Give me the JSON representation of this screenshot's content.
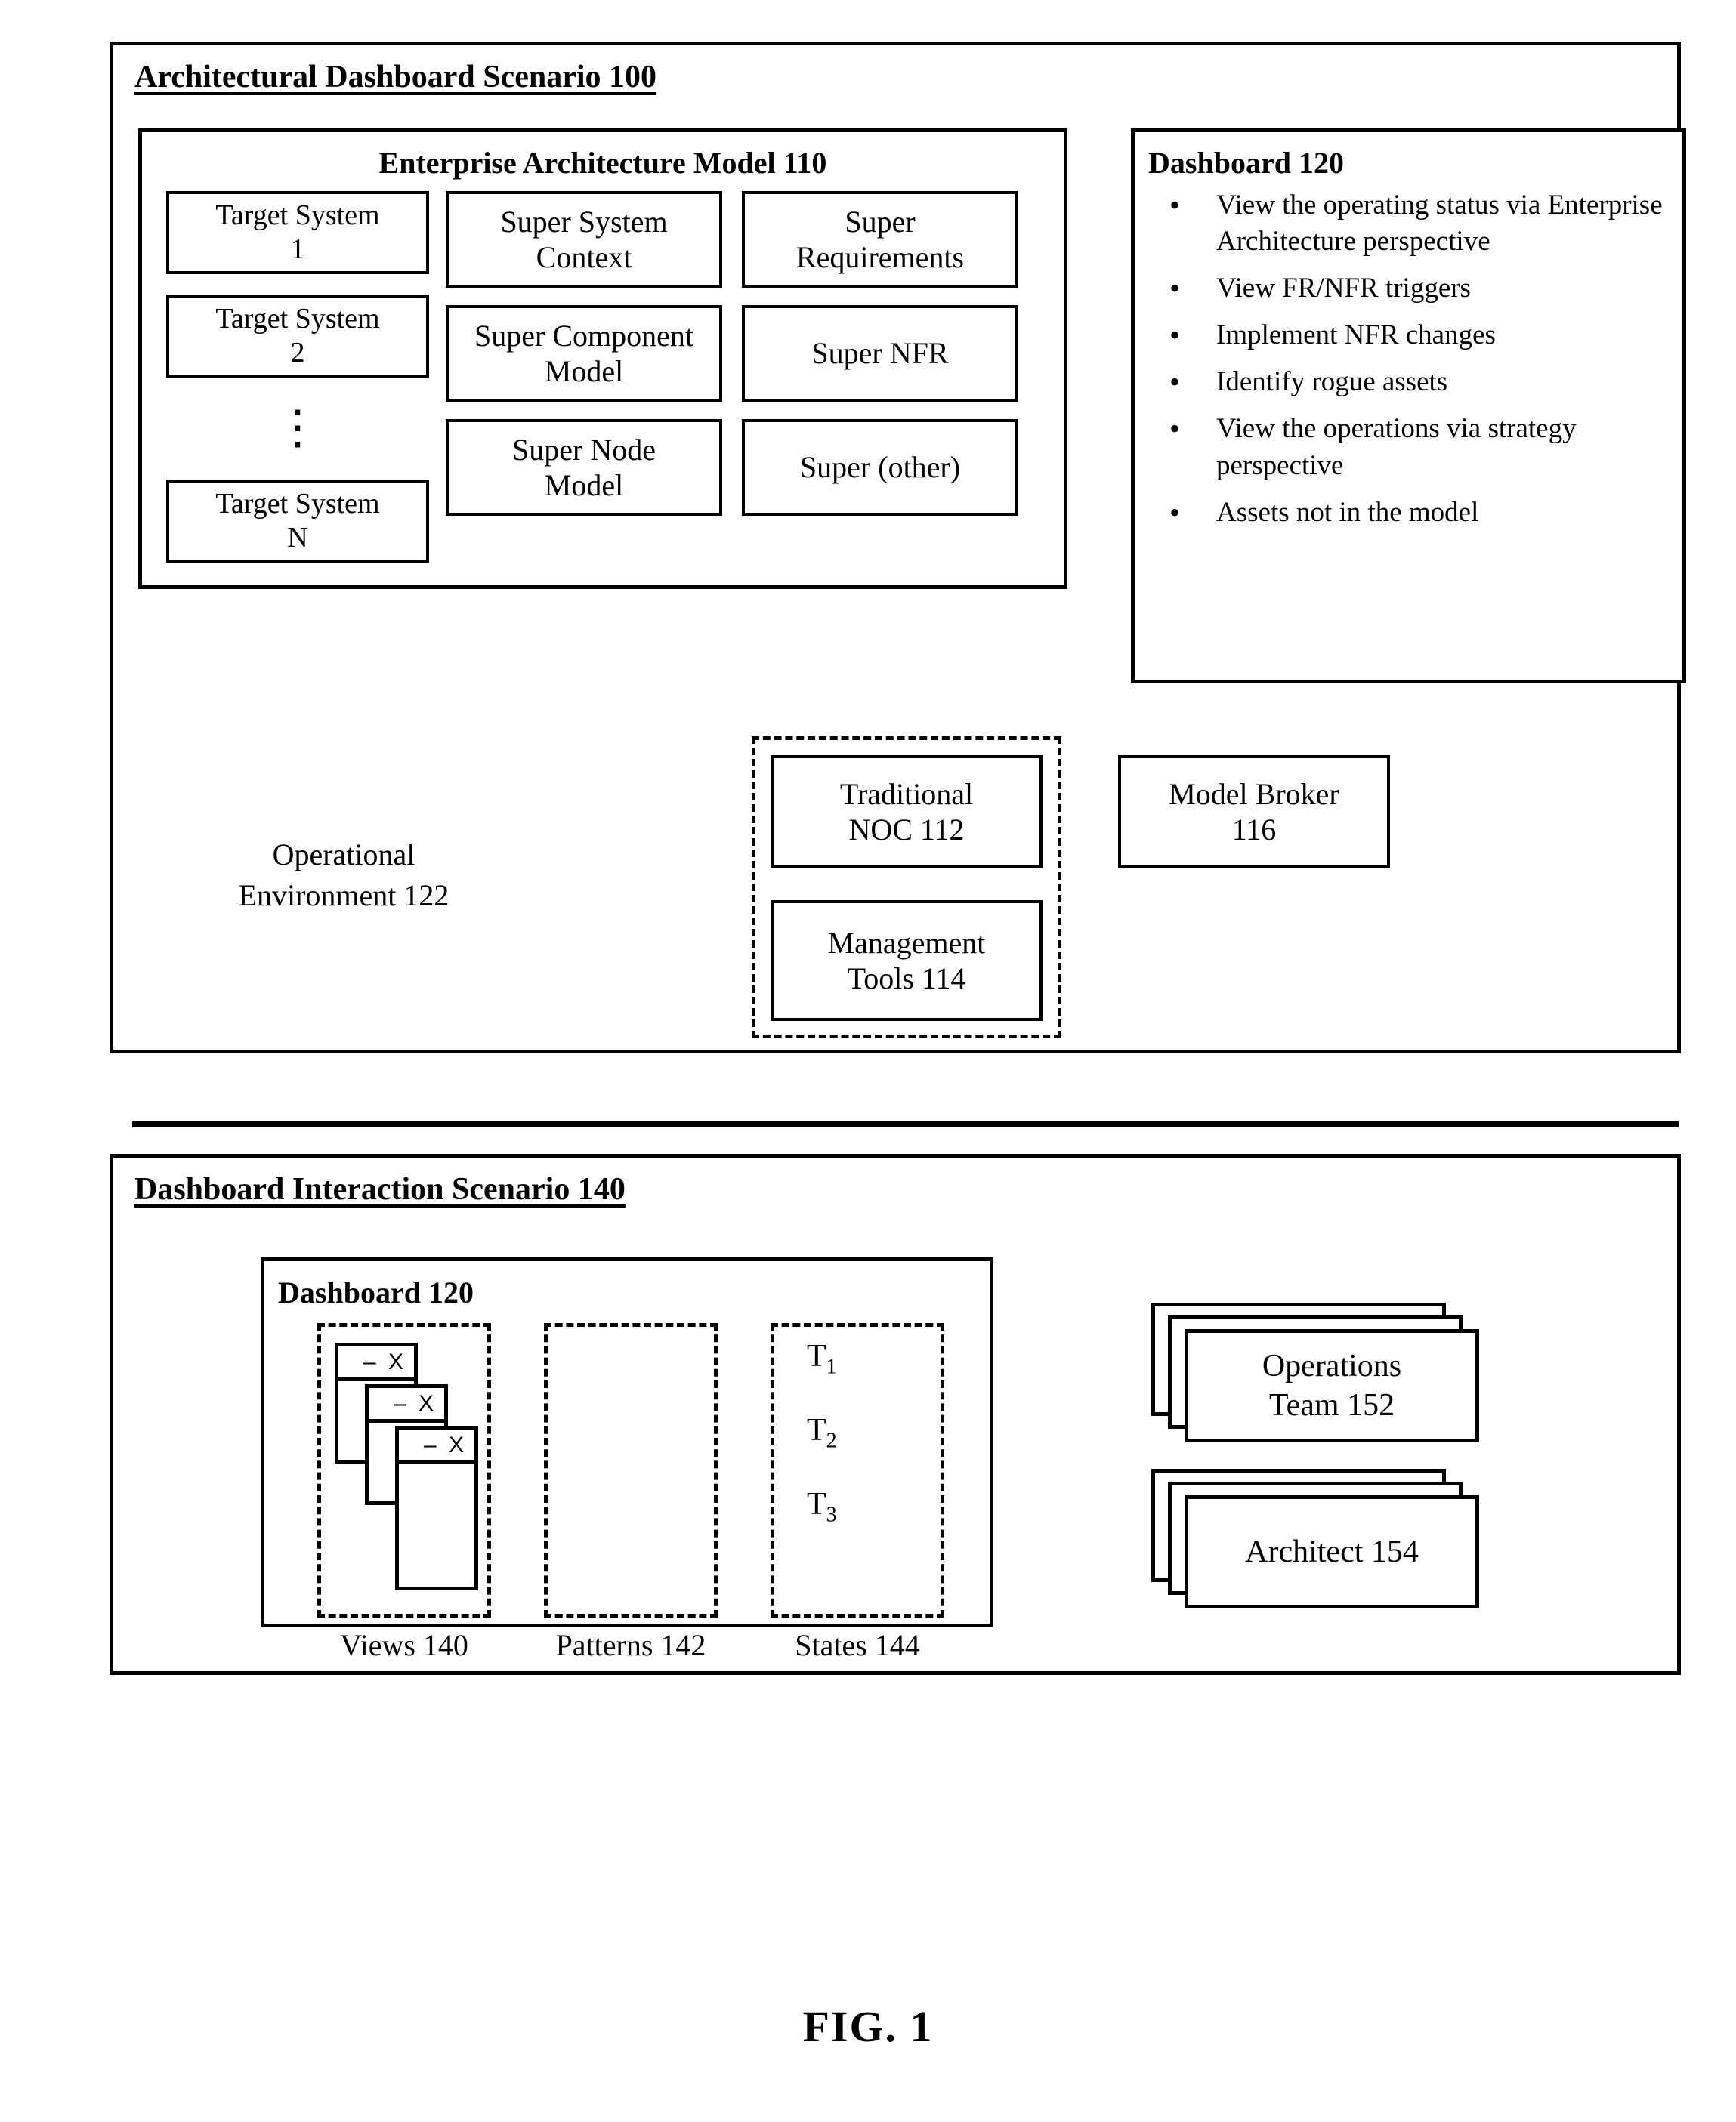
{
  "figure": {
    "label": "FIG. 1"
  },
  "scenario100": {
    "title": "Architectural Dashboard Scenario 100",
    "ea_model": {
      "title": "Enterprise Architecture Model 110",
      "target_systems": [
        "Target System\n1",
        "Target System\n2",
        "Target System\nN"
      ],
      "ellipsis": "⋮",
      "super_left": [
        "Super System\nContext",
        "Super Component\nModel",
        "Super Node\nModel"
      ],
      "super_right": [
        "Super\nRequirements",
        "Super NFR",
        "Super (other)"
      ]
    },
    "dashboard": {
      "title": "Dashboard 120",
      "bullets": [
        "View the operating status via Enterprise Architecture perspective",
        "View FR/NFR triggers",
        "Implement NFR changes",
        "Identify rogue assets",
        "View the operations via strategy perspective",
        "Assets not in the model"
      ]
    },
    "cloud": {
      "label": "Operational\nEnvironment 122"
    },
    "noc": {
      "label": "Traditional\nNOC 112"
    },
    "mgmt_tools": {
      "label": "Management\nTools 114"
    },
    "model_broker": {
      "label": "Model Broker\n116"
    }
  },
  "scenario140": {
    "title": "Dashboard Interaction Scenario 140",
    "dashboard": {
      "title": "Dashboard 120",
      "panels": [
        {
          "caption": "Views 140",
          "icon": "window-stack-icon",
          "window_controls": "– X"
        },
        {
          "caption": "Patterns 142",
          "icon": "lightning-bolt-icon"
        },
        {
          "caption": "States 144",
          "icon": "flag-icon",
          "states": [
            "T1",
            "T2",
            "T3"
          ]
        }
      ]
    },
    "actors": [
      {
        "label": "Operations\nTeam 152",
        "icon": "people-group-icon"
      },
      {
        "label": "Architect 154",
        "icon": "person-icon"
      }
    ]
  },
  "colors": {
    "stroke": "#000000",
    "background": "#ffffff"
  }
}
